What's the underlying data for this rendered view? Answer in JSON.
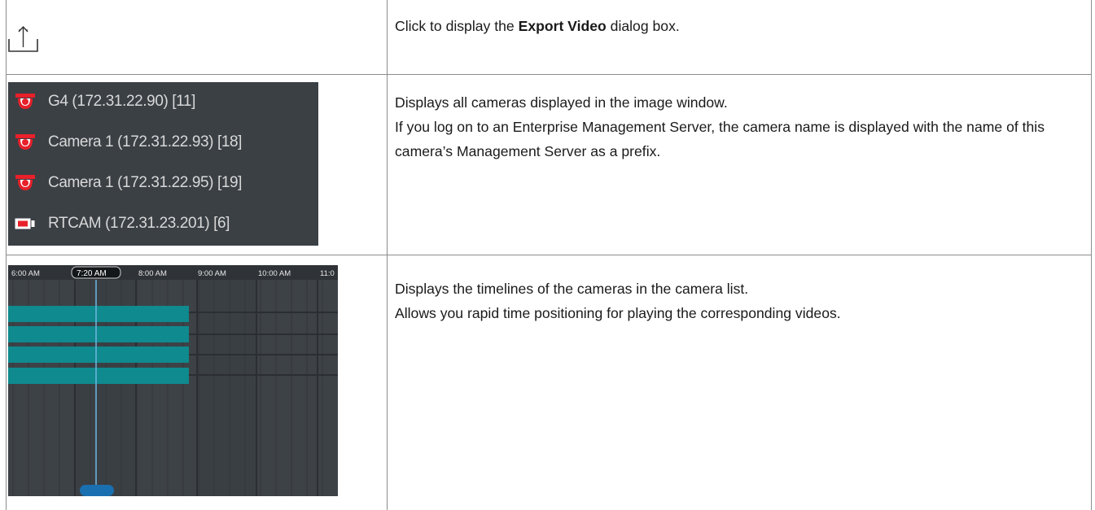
{
  "rows": [
    {
      "icon": "export-icon",
      "description_parts": [
        "Click to display the ",
        "Export Video",
        " dialog box."
      ]
    },
    {
      "cameras": [
        {
          "label": "G4 (172.31.22.90) [11]",
          "icon": "dome-camera-icon"
        },
        {
          "label": "Camera 1 (172.31.22.93) [18]",
          "icon": "dome-camera-icon"
        },
        {
          "label": "Camera 1 (172.31.22.95) [19]",
          "icon": "dome-camera-icon"
        },
        {
          "label": "RTCAM (172.31.23.201) [6]",
          "icon": "box-camera-icon"
        }
      ],
      "description_lines": [
        "Displays all cameras displayed in the image window.",
        "If you log on to an Enterprise Management Server, the camera name is displayed with the name of this camera’s Management Server as a prefix."
      ]
    },
    {
      "timeline": {
        "ticks": [
          "6:00 AM",
          "7:20 AM",
          "8:00 AM",
          "9:00 AM",
          "10:00 AM",
          "11:0"
        ],
        "current_time": "7:20 AM",
        "recording_tracks": 4
      },
      "description_lines": [
        "Displays the timelines of the cameras in the camera list.",
        "Allows you rapid time positioning for playing the corresponding videos."
      ]
    }
  ],
  "colors": {
    "camera_red": "#e8202a",
    "track_teal": "#0f8a8e",
    "timeline_bg": "#3a3f44",
    "playhead": "#6fb7e0",
    "scrub_handle": "#1a6fb0"
  }
}
